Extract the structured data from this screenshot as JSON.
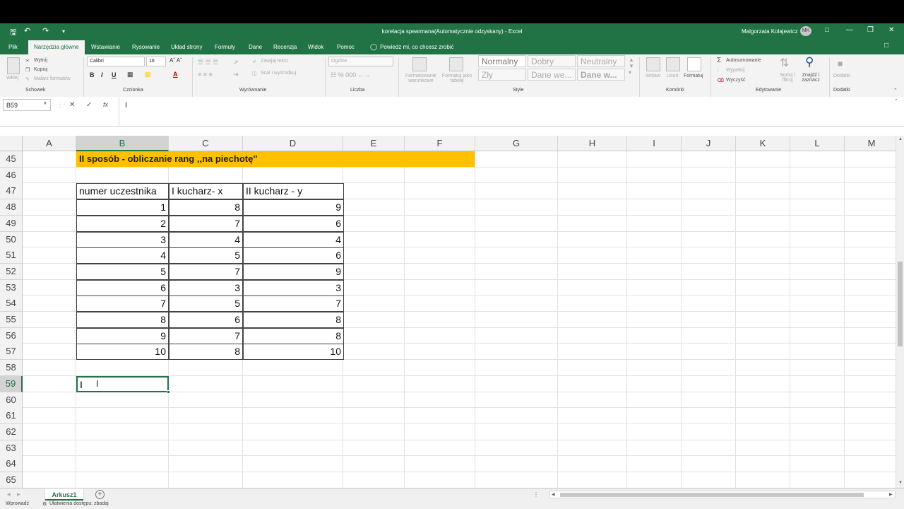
{
  "titlebar": {
    "title": "korelacja spearmana(Automatycznie odzyskany)  -  Excel",
    "user": "Malgorzata Kolajewicz",
    "avatar": "MK",
    "icons": [
      "save-icon",
      "undo-icon",
      "redo-icon",
      "customize-icon"
    ]
  },
  "tabs": [
    "Plik",
    "Narzędzia główne",
    "Wstawianie",
    "Rysowanie",
    "Układ strony",
    "Formuły",
    "Dane",
    "Recenzja",
    "Widok",
    "Pomoc"
  ],
  "tellme": "Powiedz mi, co chcesz zrobić",
  "ribbon": {
    "clipboard": {
      "paste": "Wklej",
      "cut": "Wytnij",
      "copy": "Kopiuj",
      "painter": "Malarz formatów",
      "label": "Schowek"
    },
    "font": {
      "name": "Calibri",
      "size": "16",
      "label": "Czcionka",
      "bold": "B",
      "italic": "I",
      "underline": "U",
      "color": "A"
    },
    "alignment": {
      "wrap": "Zawijaj tekst",
      "merge": "Scal i wyśrodkuj",
      "label": "Wyrównanie"
    },
    "number": {
      "format": "Ogólne",
      "label": "Liczba"
    },
    "styles": {
      "cond": "Formatowanie warunkowe",
      "table": "Formatuj jako tabelę",
      "label": "Style",
      "items": [
        "Normalny",
        "Dobry",
        "Neutralny",
        "Zły",
        "Dane we...",
        "Dane w..."
      ]
    },
    "cells": {
      "insert": "Wstaw",
      "delete": "Usuń",
      "format": "Formatuj",
      "label": "Komórki"
    },
    "editing": {
      "autosum": "Autosumowanie",
      "fill": "Wypełnij",
      "clear": "Wyczyść",
      "sort": "Sortuj i filtruj",
      "find": "Znajdź i zaznacz",
      "label": "Edytowanie"
    },
    "addins": {
      "btn": "Dodatki",
      "label": "Dodatki"
    }
  },
  "formula_bar": {
    "name_box": "B59",
    "content": "I"
  },
  "columns": [
    "A",
    "B",
    "C",
    "D",
    "E",
    "F",
    "G",
    "H",
    "I",
    "J",
    "K",
    "L",
    "M"
  ],
  "rows": [
    "45",
    "46",
    "47",
    "48",
    "49",
    "50",
    "51",
    "52",
    "53",
    "54",
    "55",
    "56",
    "57",
    "58",
    "59",
    "60",
    "61",
    "62",
    "63",
    "64",
    "65"
  ],
  "sheet": {
    "banner": "II sposób - obliczanie rang  ,,na piechotę''",
    "headers": [
      "numer uczestnika",
      "I kucharz- x",
      "II kucharz - y"
    ],
    "data": [
      [
        "1",
        "8",
        "9"
      ],
      [
        "2",
        "7",
        "6"
      ],
      [
        "3",
        "4",
        "4"
      ],
      [
        "4",
        "5",
        "6"
      ],
      [
        "5",
        "7",
        "9"
      ],
      [
        "6",
        "3",
        "3"
      ],
      [
        "7",
        "5",
        "7"
      ],
      [
        "8",
        "6",
        "8"
      ],
      [
        "9",
        "7",
        "8"
      ],
      [
        "10",
        "8",
        "10"
      ]
    ],
    "active_cell_text": "I"
  },
  "sheet_tab": "Arkusz1",
  "status": {
    "mode": "Wprowadź",
    "accessibility": "Ułatwienia dostępu: zbadaj"
  },
  "accent_color": "#217346",
  "banner_color": "#ffc000"
}
